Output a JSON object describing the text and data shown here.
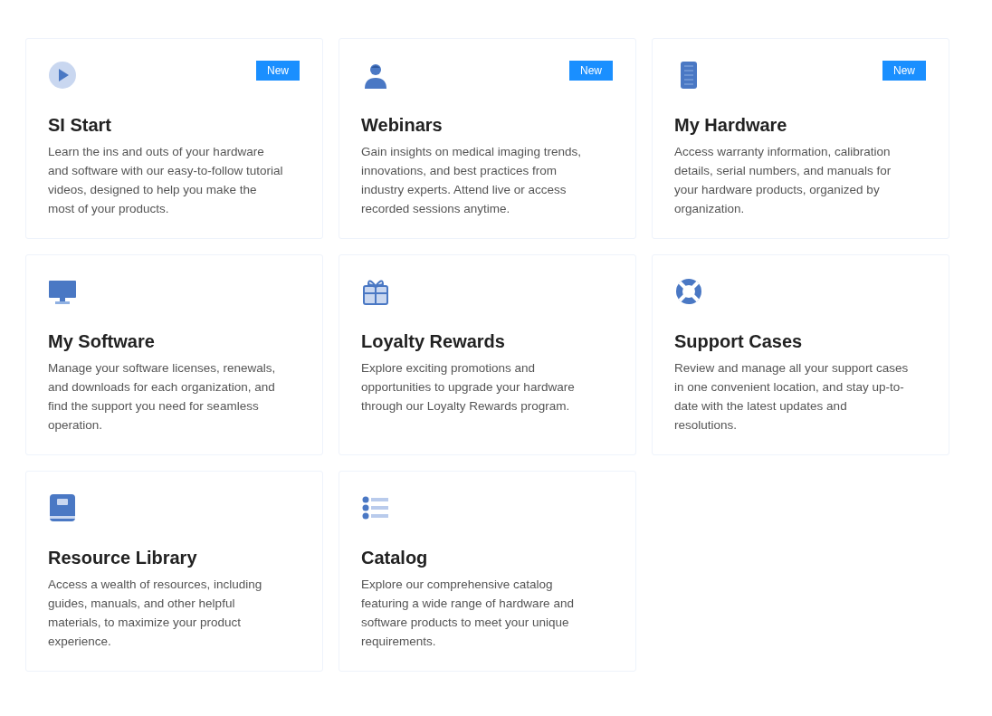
{
  "cards": [
    {
      "badge": "New",
      "title": "SI Start",
      "description": "Learn the ins and outs of your hardware and software with our easy-to-follow tutorial videos, designed to help you make the most of your products."
    },
    {
      "badge": "New",
      "title": "Webinars",
      "description": "Gain insights on medical imaging trends, innovations, and best practices from industry experts. Attend live or access recorded sessions anytime."
    },
    {
      "badge": "New",
      "title": "My Hardware",
      "description": "Access warranty information, calibration details, serial numbers, and manuals for your hardware products, organized by organization."
    },
    {
      "title": "My Software",
      "description": "Manage your software licenses, renewals, and downloads for each organization, and find the support you need for seamless operation."
    },
    {
      "title": "Loyalty Rewards",
      "description": "Explore exciting promotions and opportunities to upgrade your hardware through our Loyalty Rewards program."
    },
    {
      "title": "Support Cases",
      "description": "Review and manage all your support cases in one convenient location, and stay up-to-date with the latest updates and resolutions."
    },
    {
      "title": "Resource Library",
      "description": "Access a wealth of resources, including guides, manuals, and other helpful materials, to maximize your product experience."
    },
    {
      "title": "Catalog",
      "description": "Explore our comprehensive catalog featuring a wide range of hardware and software products to meet your unique requirements."
    }
  ]
}
